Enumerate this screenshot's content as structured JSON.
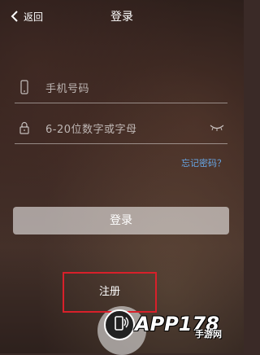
{
  "header": {
    "back_label": "返回",
    "title": "登录"
  },
  "form": {
    "phone_placeholder": "手机号码",
    "password_placeholder": "6-20位数字或字母",
    "forgot_label": "忘记密码？"
  },
  "buttons": {
    "login_label": "登录",
    "register_label": "注册"
  },
  "watermark": {
    "main": "APP178",
    "cn": "手游网"
  },
  "colors": {
    "link": "#67a7e6",
    "highlight_border": "#d8202a"
  }
}
